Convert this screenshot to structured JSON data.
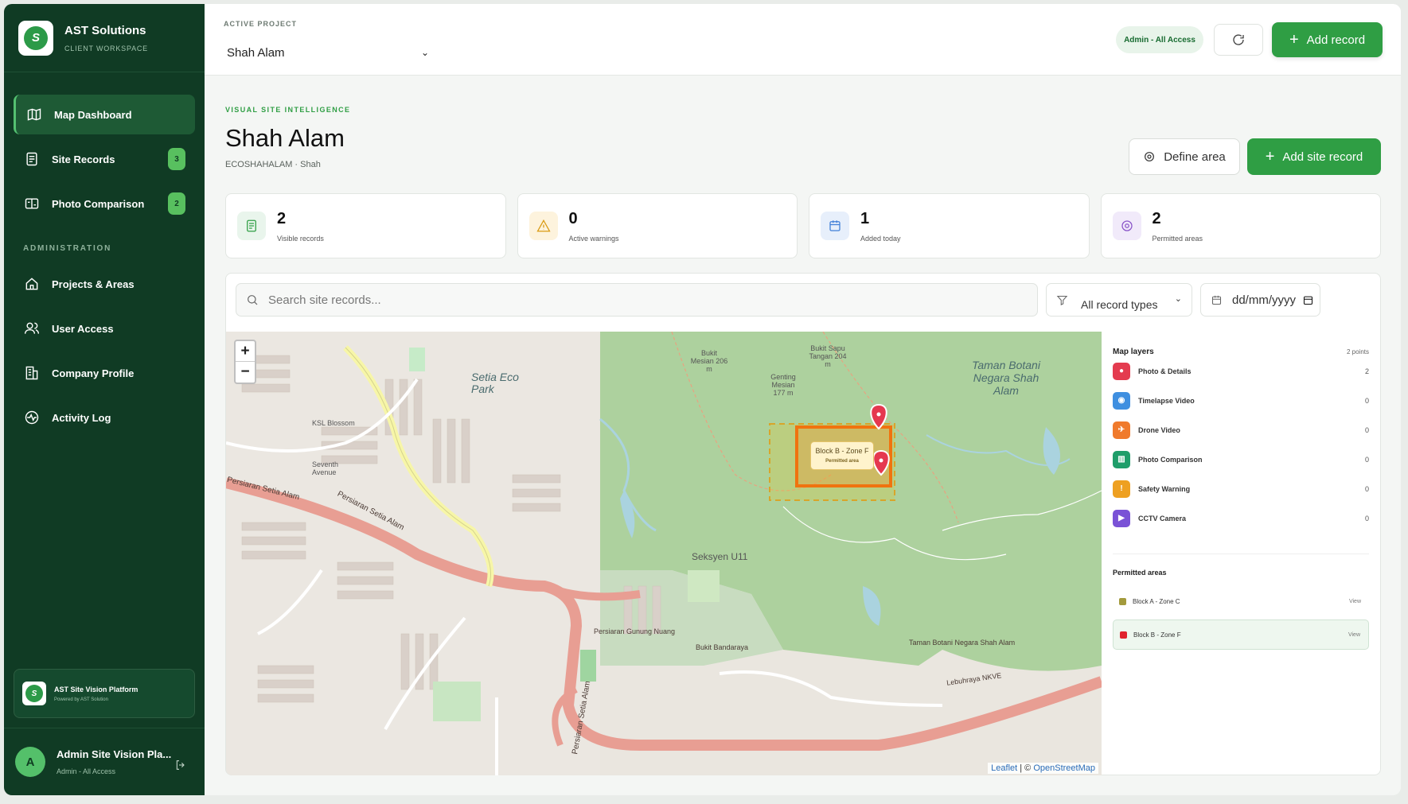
{
  "brand": {
    "name": "AST Solutions",
    "subtitle": "CLIENT WORKSPACE",
    "logo_text": "S"
  },
  "nav": [
    {
      "label": "Map Dashboard",
      "icon": "map-icon"
    },
    {
      "label": "Site Records",
      "icon": "document-icon",
      "badge": "3"
    },
    {
      "label": "Photo Comparison",
      "icon": "compare-icon",
      "badge": "2"
    }
  ],
  "admin_section": "ADMINISTRATION",
  "admin_nav": [
    {
      "label": "Projects & Areas",
      "icon": "home-icon"
    },
    {
      "label": "User Access",
      "icon": "users-icon"
    },
    {
      "label": "Company Profile",
      "icon": "building-icon"
    },
    {
      "label": "Activity Log",
      "icon": "activity-icon"
    }
  ],
  "platform": {
    "title": "AST Site Vision Platform",
    "subtitle": "Powered by AST Solution"
  },
  "user": {
    "initial": "A",
    "name": "Admin Site Vision Pla...",
    "role": "Admin - All Access"
  },
  "topbar": {
    "project_label": "ACTIVE PROJECT",
    "project_value": "Shah Alam",
    "role_pill": "Admin - All Access",
    "add_record": "Add record"
  },
  "header": {
    "kicker": "VISUAL SITE INTELLIGENCE",
    "title": "Shah Alam",
    "subtitle": "ECOSHAHALAM · Shah",
    "define_area": "Define area",
    "add_site_record": "Add site record"
  },
  "stats": [
    {
      "value": "2",
      "label": "Visible records",
      "icon": "document-icon",
      "color": "#2f9e44",
      "bg": "#e9f5ec"
    },
    {
      "value": "0",
      "label": "Active warnings",
      "icon": "warning-icon",
      "color": "#d99a12",
      "bg": "#fdf3dd"
    },
    {
      "value": "1",
      "label": "Added today",
      "icon": "calendar-icon",
      "color": "#3f7fd8",
      "bg": "#e7effb"
    },
    {
      "value": "2",
      "label": "Permitted areas",
      "icon": "target-icon",
      "color": "#8a55c9",
      "bg": "#f1eafa"
    }
  ],
  "filters": {
    "search_placeholder": "Search site records...",
    "record_type": "All record types",
    "date_placeholder": "dd/mm/yyyy"
  },
  "map": {
    "labels": {
      "setia_eco_park": "Setia Eco Park",
      "taman_botani": "Taman Botani Negara Shah Alam",
      "seksyen": "Seksyen U11",
      "bukit_mesian": "Bukit Mesian 206 m",
      "bukit_sapu": "Bukit Sapu Tangan 204 m",
      "genting": "Genting Mesian 177 m",
      "persiaran_setia_alam": "Persiaran Setia Alam",
      "persiaran_setia_alam_2": "Persiaran Setia Alam",
      "persiaran_setia_alam_3": "Persiaran Setia Alam",
      "ksl": "KSL Blossom",
      "seventh": "Seventh Avenue",
      "lebuhraya": "Lebuhraya NKVE",
      "gunung_nuang": "Persiaran Gunung Nuang",
      "bukit_bandaraya": "Bukit Bandaraya",
      "taman_botani_road": "Taman Botani Negara Shah Alam"
    },
    "popup_title": "Block B - Zone F",
    "popup_sub": "Permitted area",
    "zoom_in": "+",
    "zoom_out": "−",
    "attribution_leaflet": "Leaflet",
    "attribution_sep": "| ©",
    "attribution_osm": "OpenStreetMap"
  },
  "layers": {
    "title": "Map layers",
    "count": "2 points",
    "items": [
      {
        "label": "Photo & Details",
        "count": "2",
        "color": "#e43b4f",
        "glyph": "●"
      },
      {
        "label": "Timelapse Video",
        "count": "0",
        "color": "#3f8fe0",
        "glyph": "◉"
      },
      {
        "label": "Drone Video",
        "count": "0",
        "color": "#f07a2c",
        "glyph": "✈"
      },
      {
        "label": "Photo Comparison",
        "count": "0",
        "color": "#1f9e6a",
        "glyph": "▥"
      },
      {
        "label": "Safety Warning",
        "count": "0",
        "color": "#eea021",
        "glyph": "!"
      },
      {
        "label": "CCTV Camera",
        "count": "0",
        "color": "#7a52d6",
        "glyph": "▶"
      }
    ],
    "permitted_title": "Permitted areas",
    "permitted": [
      {
        "label": "Block A - Zone C",
        "color": "#a39a3c",
        "view": "View"
      },
      {
        "label": "Block B - Zone F",
        "color": "#e0222e",
        "view": "View"
      }
    ]
  }
}
